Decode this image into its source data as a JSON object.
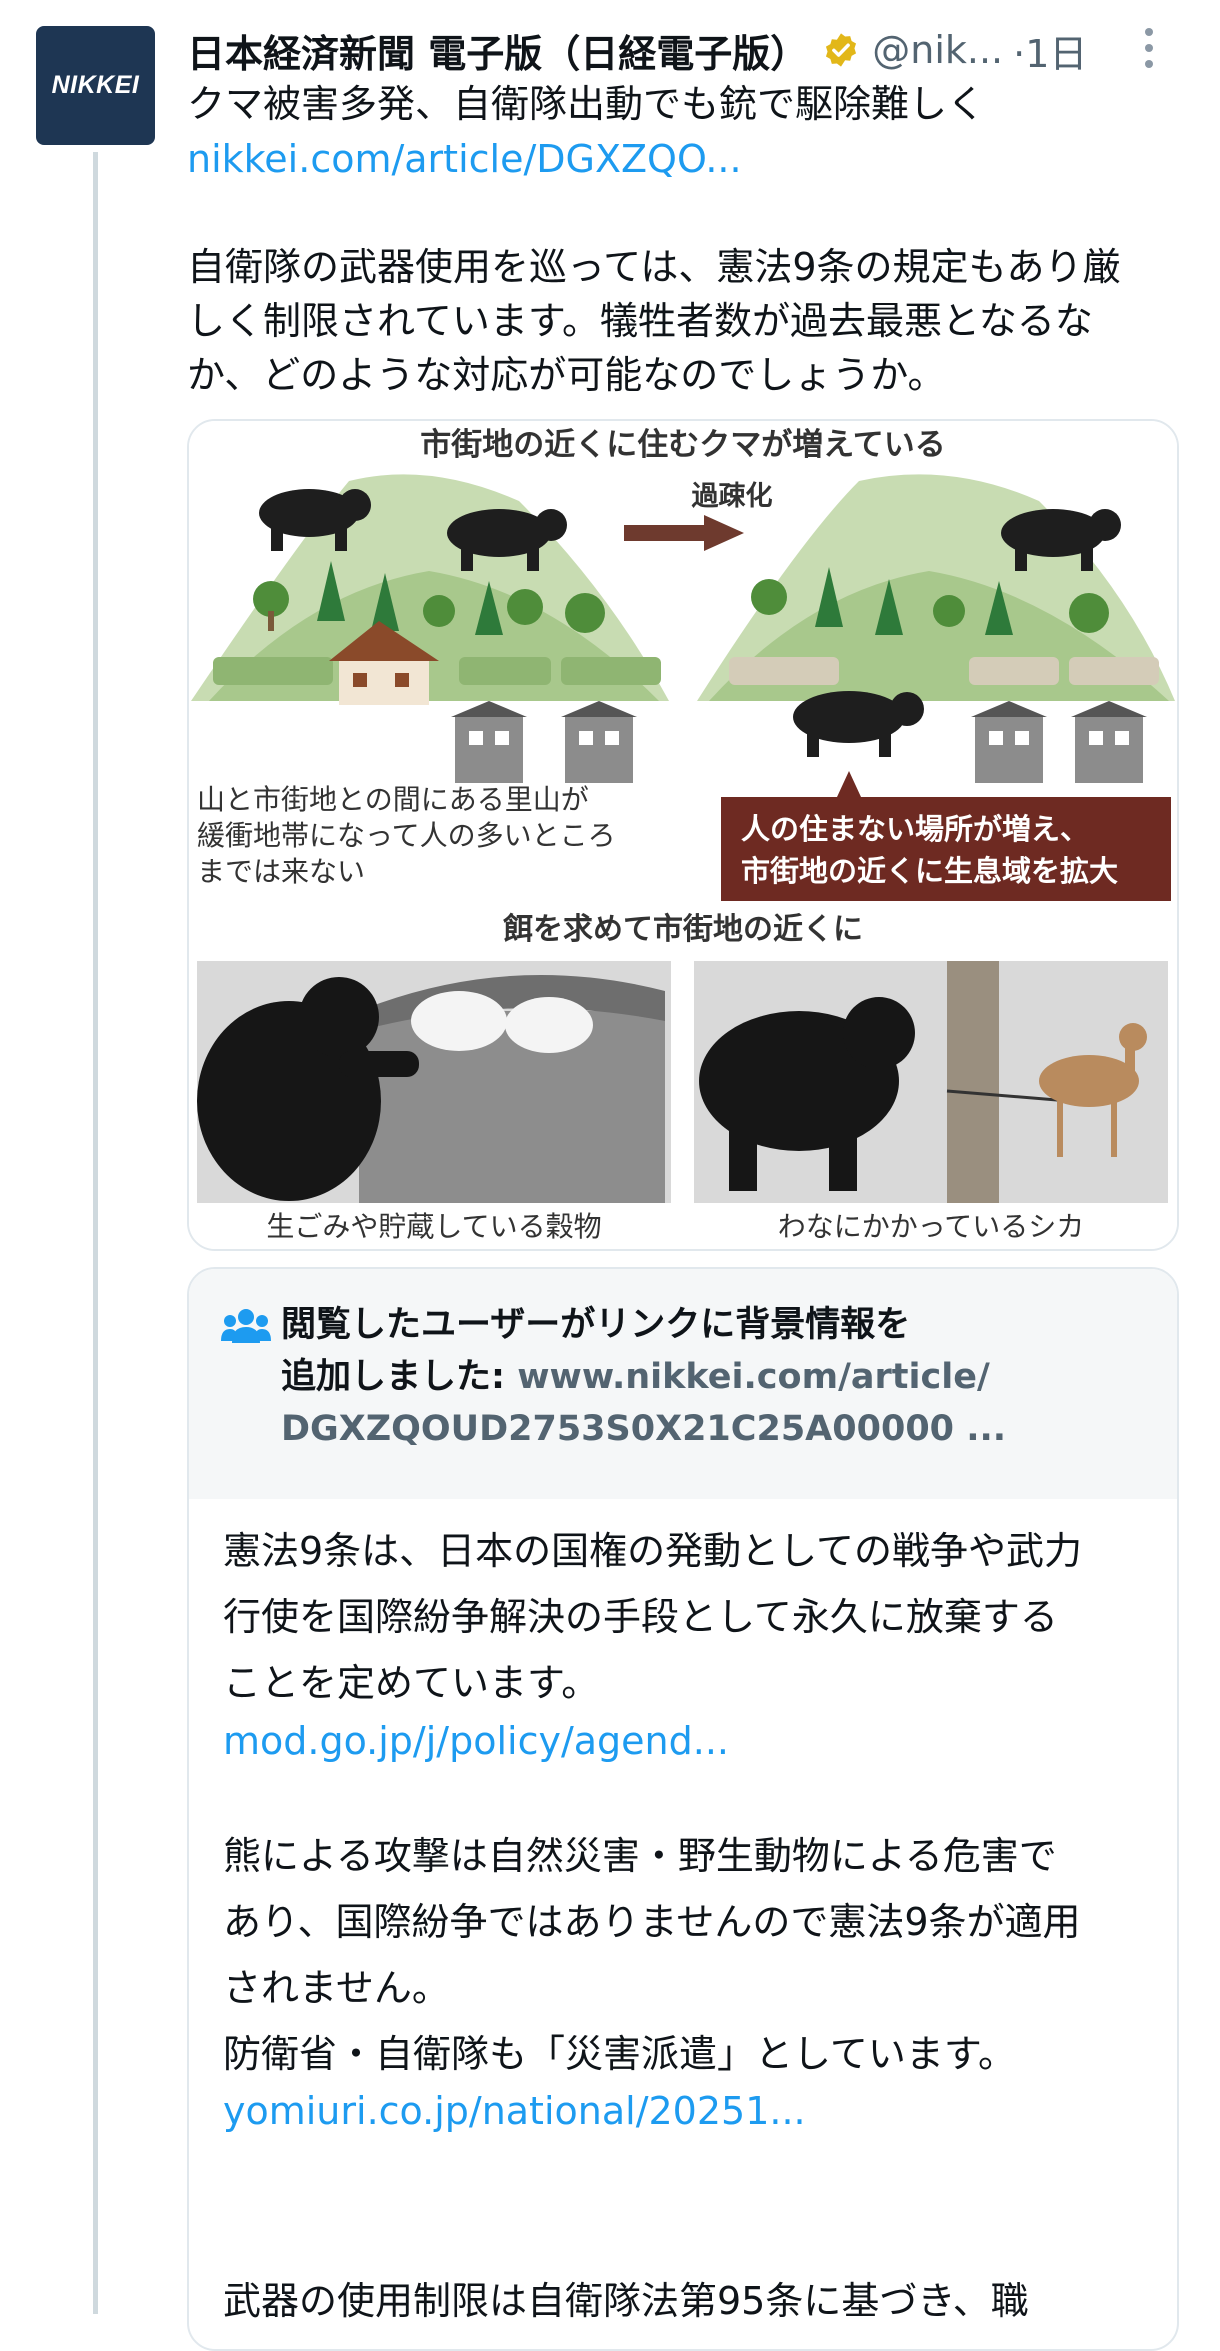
{
  "tweet": {
    "avatar_text": "NIKKEI",
    "display_name": "日本経済新聞 電子版（日経電子版）",
    "handle": "@nik...",
    "time": "·1日",
    "text_lines": [
      "クマ被害多発、自衛隊出動でも銃で駆除難しく",
      "nikkei.com/article/DGXZQO...",
      "",
      "自衛隊の武器使用を巡っては、憲法9条の規定もあり厳",
      "しく制限されています。犠牲者数が過去最悪となるな",
      "か、どのような対応が可能なのでしょうか。"
    ],
    "colors": {
      "link": "#1d9bf0",
      "verified_badge": "#e2b719",
      "avatar_bg": "#1e3653"
    }
  },
  "infographic": {
    "title": "市街地の近くに住むクマが増えている",
    "arrow_label": "過疎化",
    "left_caption": [
      "山と市街地との間にある里山が",
      "緩衝地帯になって人の多いところ",
      "までは来ない"
    ],
    "right_caption": [
      "人の住まない場所が増え、",
      "市街地の近くに生息域を拡大"
    ],
    "subtitle": "餌を求めて市街地の近くに",
    "photo_left_caption": "生ごみや貯蔵している穀物",
    "photo_right_caption": "わなにかかっているシカ"
  },
  "community_note": {
    "icon": "people-icon",
    "title_line1": "閲覧したユーザーがリンクに背景情報を",
    "title_line2_prefix": "追加しました: ",
    "url_line1": "www.nikkei.com/article/",
    "url_line2": "DGXZQOUD2753S0X21C25A00000 ...",
    "body_lines": [
      "憲法9条は、日本の国権の発動としての戦争や武力",
      "行使を国際紛争解決の手段として永久に放棄する",
      "ことを定めています。",
      "mod.go.jp/j/policy/agend...",
      "",
      "熊による攻撃は自然災害・野生動物による危害で",
      "あり、国際紛争ではありませんので憲法9条が適用",
      "されません。",
      "防衛省・自衛隊も「災害派遣」としています。",
      "yomiuri.co.jp/national/20251...",
      "",
      "",
      "武器の使用制限は自衛隊法第95条に基づき、職"
    ]
  }
}
